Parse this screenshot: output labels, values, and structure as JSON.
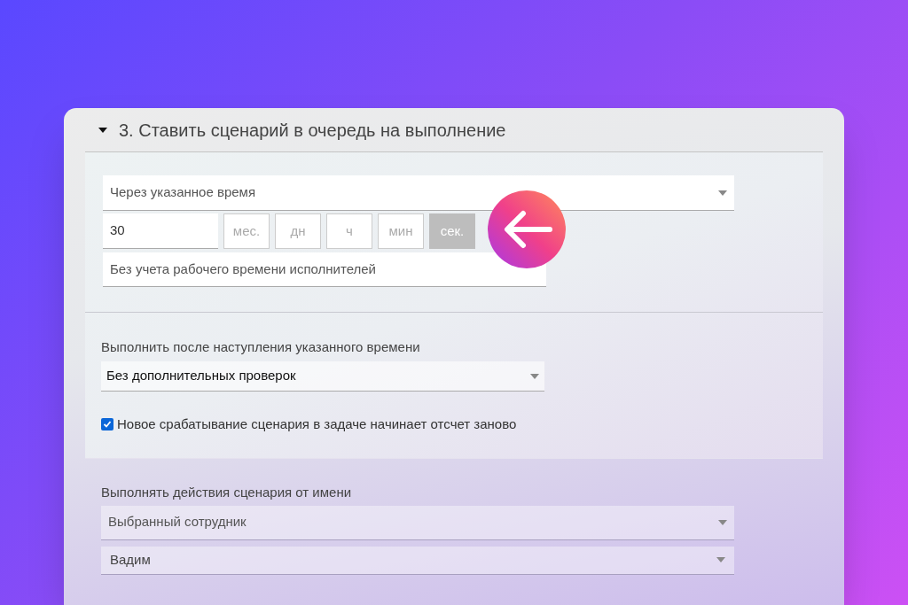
{
  "section": {
    "title": "3. Ставить сценарий в очередь на выполнение",
    "expanded": true
  },
  "delay": {
    "mode": "Через указанное время",
    "amount": "30",
    "units": [
      {
        "label": "мес.",
        "selected": false
      },
      {
        "label": "дн",
        "selected": false
      },
      {
        "label": "ч",
        "selected": false
      },
      {
        "label": "мин",
        "selected": false
      },
      {
        "label": "сек.",
        "selected": true
      }
    ],
    "work_time": "Без учета рабочего времени исполнителей"
  },
  "after": {
    "label": "Выполнить после наступления указанного времени",
    "value": "Без дополнительных проверок",
    "restart_checkbox": {
      "label": "Новое срабатывание сценария в задаче начинает отсчет заново",
      "checked": true
    }
  },
  "run_as": {
    "label": "Выполнять действия сценария от имени",
    "mode": "Выбранный сотрудник",
    "user": "Вадим"
  }
}
